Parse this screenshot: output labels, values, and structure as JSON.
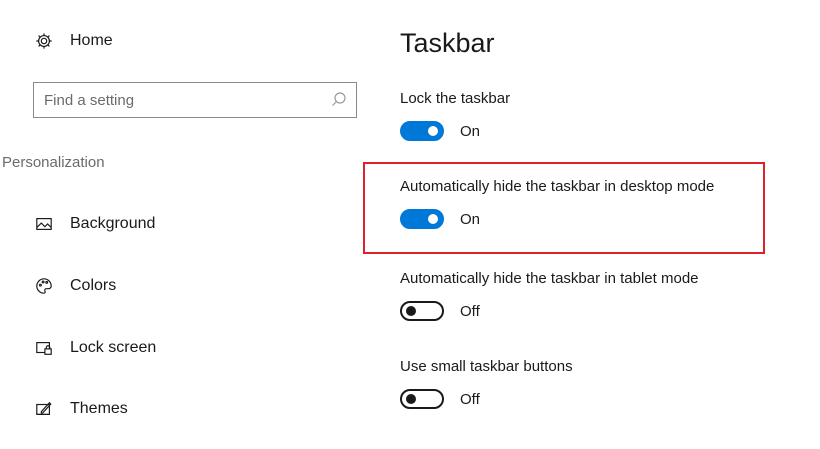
{
  "sidebar": {
    "home_label": "Home",
    "search_placeholder": "Find a setting",
    "section_label": "Personalization",
    "items": [
      {
        "label": "Background",
        "icon": "picture-icon"
      },
      {
        "label": "Colors",
        "icon": "palette-icon"
      },
      {
        "label": "Lock screen",
        "icon": "lock-screen-icon"
      },
      {
        "label": "Themes",
        "icon": "themes-icon"
      }
    ]
  },
  "main": {
    "title": "Taskbar",
    "settings": [
      {
        "label": "Lock the taskbar",
        "state": "On",
        "enabled": true
      },
      {
        "label": "Automatically hide the taskbar in desktop mode",
        "state": "On",
        "enabled": true
      },
      {
        "label": "Automatically hide the taskbar in tablet mode",
        "state": "Off",
        "enabled": false
      },
      {
        "label": "Use small taskbar buttons",
        "state": "Off",
        "enabled": false
      }
    ]
  },
  "colors": {
    "accent": "#0078d7",
    "highlight": "#e0202a"
  }
}
